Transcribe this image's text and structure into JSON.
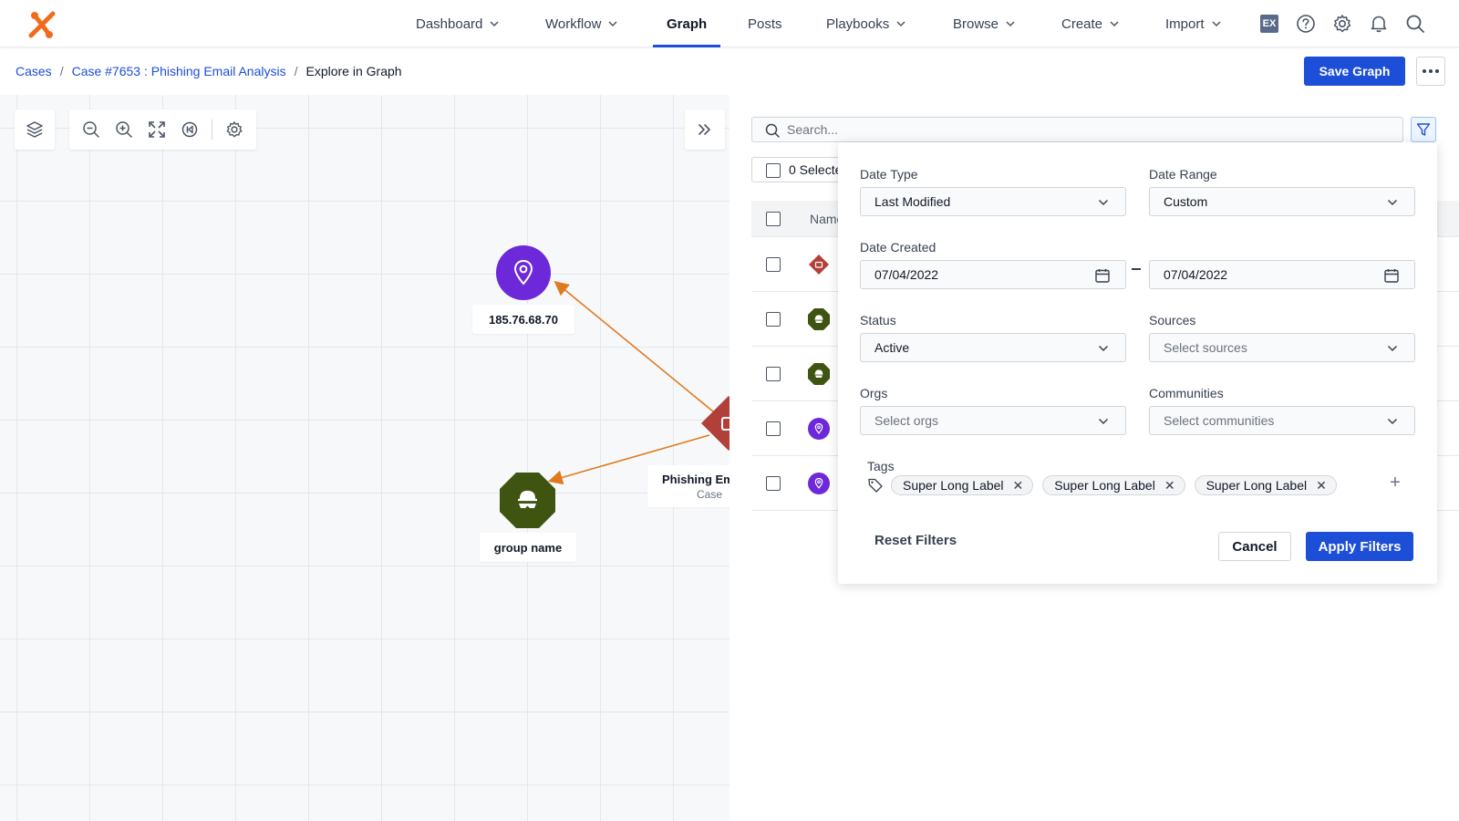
{
  "nav": {
    "items": [
      {
        "label": "Dashboard",
        "has_dropdown": true
      },
      {
        "label": "Workflow",
        "has_dropdown": true
      },
      {
        "label": "Graph",
        "has_dropdown": false,
        "active": true
      },
      {
        "label": "Posts",
        "has_dropdown": false
      },
      {
        "label": "Playbooks",
        "has_dropdown": true
      },
      {
        "label": "Browse",
        "has_dropdown": true
      },
      {
        "label": "Create",
        "has_dropdown": true
      },
      {
        "label": "Import",
        "has_dropdown": true
      }
    ],
    "badge": "EX",
    "icons": [
      "help-icon",
      "gear-icon",
      "bell-icon",
      "search-icon"
    ],
    "accent": "#1d4ed8"
  },
  "breadcrumb": {
    "items": [
      "Cases",
      "Case #7653 : Phishing Email Analysis",
      "Explore in Graph"
    ],
    "separator": "/"
  },
  "header": {
    "save_label": "Save Graph"
  },
  "graph": {
    "nodes": [
      {
        "label": "185.76.68.70",
        "type": "indicator",
        "color": "#6d28d9"
      },
      {
        "label": "group name",
        "type": "threat-actor",
        "color": "#3f5411"
      },
      {
        "label": "Phishing Em",
        "sublabel": "Case",
        "type": "case",
        "color": "#b2403a"
      }
    ],
    "edge_color": "#e07a1f"
  },
  "panel": {
    "search_placeholder": "Search...",
    "selected_label": "0 Selecte",
    "column_name": "Name",
    "rows": [
      {
        "icon": "case-icon",
        "color": "#b2403a"
      },
      {
        "icon": "threat-actor-icon",
        "color": "#3f5411"
      },
      {
        "icon": "threat-actor-icon",
        "color": "#3f5411"
      },
      {
        "icon": "indicator-icon",
        "color": "#6d28d9"
      },
      {
        "icon": "indicator-icon",
        "color": "#6d28d9"
      }
    ]
  },
  "filters": {
    "date_type": {
      "label": "Date Type",
      "value": "Last Modified"
    },
    "date_range": {
      "label": "Date Range",
      "value": "Custom"
    },
    "date_created": {
      "label": "Date Created",
      "from": "07/04/2022",
      "to": "07/04/2022"
    },
    "status": {
      "label": "Status",
      "value": "Active"
    },
    "sources": {
      "label": "Sources",
      "placeholder": "Select sources"
    },
    "orgs": {
      "label": "Orgs",
      "placeholder": "Select orgs"
    },
    "communities": {
      "label": "Communities",
      "placeholder": "Select communities"
    },
    "tags": {
      "label": "Tags",
      "items": [
        "Super Long Label",
        "Super Long Label",
        "Super Long Label"
      ]
    },
    "reset_label": "Reset Filters",
    "cancel_label": "Cancel",
    "apply_label": "Apply Filters"
  }
}
